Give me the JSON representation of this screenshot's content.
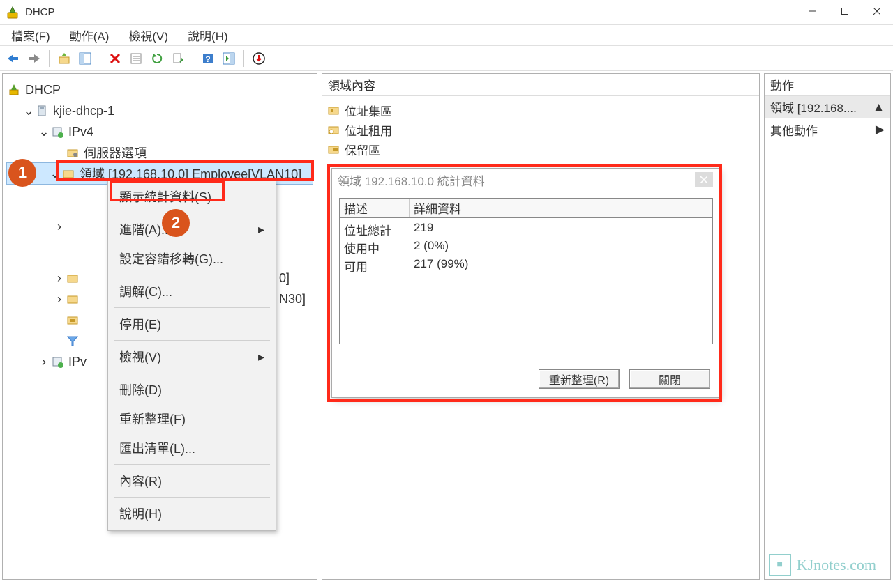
{
  "window": {
    "title": "DHCP"
  },
  "menubar": {
    "file": "檔案(F)",
    "action": "動作(A)",
    "view": "檢視(V)",
    "help": "說明(H)"
  },
  "tree": {
    "root": "DHCP",
    "server": "kjie-dhcp-1",
    "ipv4": "IPv4",
    "server_options": "伺服器選項",
    "scope_selected": "領域 [192.168.10.0] Employee[VLAN10]",
    "partial_item_0": "0]",
    "partial_item_n30": "N30]",
    "ipv6_partial": "IPv"
  },
  "middle": {
    "header": "領域內容",
    "items": [
      "位址集區",
      "位址租用",
      "保留區"
    ]
  },
  "right": {
    "header": "動作",
    "scope_header": "領域 [192.168....",
    "other_actions": "其他動作"
  },
  "context_menu": {
    "show_stats": "顯示統計資料(S)...",
    "advanced": "進階(A)...",
    "configure_failover": "設定容錯移轉(G)...",
    "reconcile": "調解(C)...",
    "deactivate": "停用(E)",
    "view": "檢視(V)",
    "delete": "刪除(D)",
    "refresh": "重新整理(F)",
    "export_list": "匯出清單(L)...",
    "properties": "內容(R)",
    "help": "說明(H)"
  },
  "dialog": {
    "title": "領域 192.168.10.0 統計資料",
    "col_desc": "描述",
    "col_detail": "詳細資料",
    "rows": [
      {
        "desc": "位址總計",
        "detail": "219"
      },
      {
        "desc": "使用中",
        "detail": "2 (0%)"
      },
      {
        "desc": "可用",
        "detail": "217 (99%)"
      }
    ],
    "refresh": "重新整理(R)",
    "close": "關閉"
  },
  "watermark": "KJnotes.com"
}
